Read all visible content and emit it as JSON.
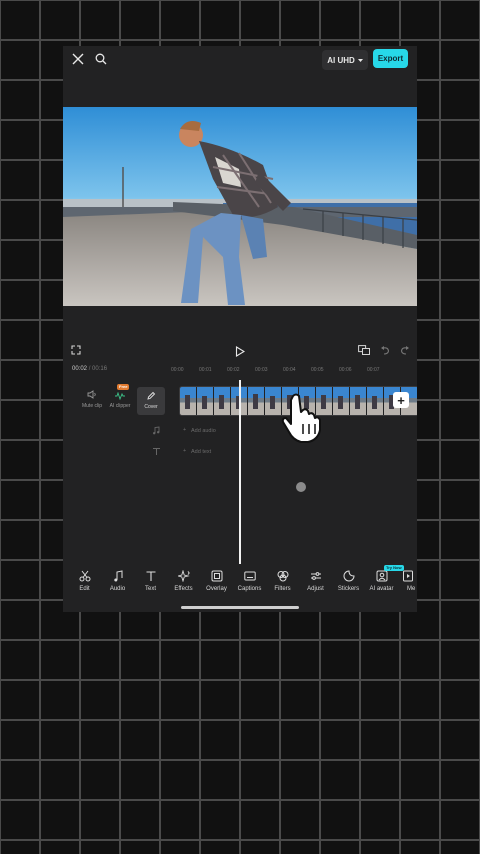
{
  "top_bar": {
    "close_icon": "close-icon",
    "search_icon": "search-icon",
    "resolution_label": "AI UHD",
    "export_label": "Export"
  },
  "controls": {
    "fullscreen_icon": "fullscreen-icon",
    "play_icon": "play-icon",
    "aspect_icon": "aspect-ratio-icon",
    "undo_icon": "undo-icon",
    "redo_icon": "redo-icon"
  },
  "timeline": {
    "current_time": "00:02",
    "total_time": "00:16",
    "ticks": [
      "00:00",
      "00:01",
      "00:02",
      "00:03",
      "00:04",
      "00:05",
      "00:06",
      "00:07"
    ],
    "tools": [
      {
        "label": "Mute clip",
        "icon": "speaker-icon"
      },
      {
        "label": "AI clipper",
        "icon": "waveform-icon",
        "badge": "Free"
      },
      {
        "label": "Cover",
        "icon": "pencil-icon"
      }
    ],
    "add_audio_label": "Add audio",
    "add_text_label": "Add text"
  },
  "toolbar": {
    "items": [
      {
        "label": "Edit",
        "icon": "scissors-icon"
      },
      {
        "label": "Audio",
        "icon": "music-note-icon"
      },
      {
        "label": "Text",
        "icon": "text-icon"
      },
      {
        "label": "Effects",
        "icon": "sparkle-icon"
      },
      {
        "label": "Overlay",
        "icon": "overlay-icon"
      },
      {
        "label": "Captions",
        "icon": "captions-icon"
      },
      {
        "label": "Filters",
        "icon": "filters-icon"
      },
      {
        "label": "Adjust",
        "icon": "sliders-icon"
      },
      {
        "label": "Stickers",
        "icon": "sticker-icon"
      },
      {
        "label": "AI avatar",
        "icon": "avatar-icon",
        "badge": "Try Now"
      },
      {
        "label": "Me",
        "icon": "media-icon"
      }
    ]
  },
  "colors": {
    "accent": "#27d8e8",
    "panel": "#222223",
    "badge_orange": "#e07a2f"
  }
}
